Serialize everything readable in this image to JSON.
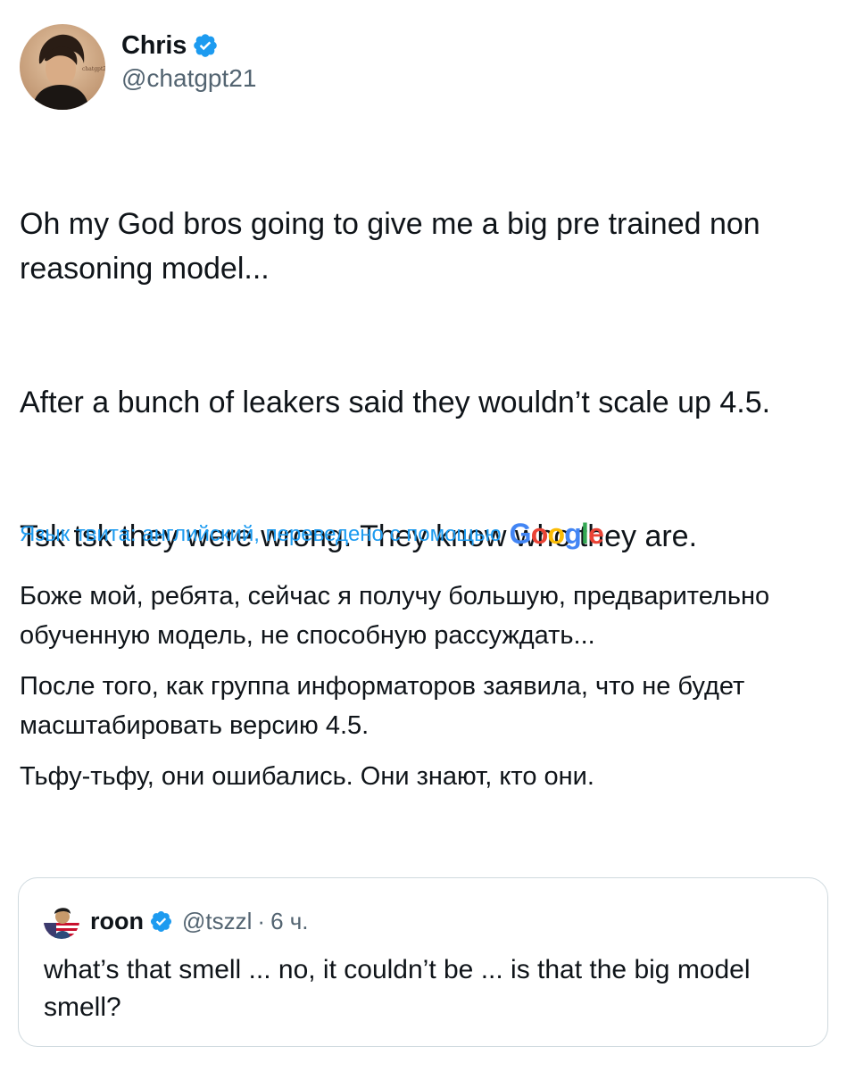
{
  "author": {
    "name": "Chris",
    "handle": "@chatgpt21",
    "avatar_label": "chatgpt21",
    "verified_icon": "verified-badge-icon"
  },
  "tweet": {
    "paragraphs": [
      "Oh my God bros going to give me a big pre trained non reasoning model...",
      "After a bunch of leakers said they wouldn’t scale up 4.5.",
      "Tsk tsk they were wrong. They know who they are."
    ]
  },
  "translation": {
    "label": "Язык твита: английский, переведено с помощью",
    "provider": "Google",
    "paragraphs": [
      "Боже мой, ребята, сейчас я получу большую, предварительно обученную модель, не способную рассуждать...",
      "После того, как группа информаторов заявила, что не будет масштабировать версию 4.5.",
      "Тьфу-тьфу, они ошибались. Они знают, кто они."
    ]
  },
  "quoted_tweet": {
    "name": "roon",
    "handle": "@tszzl",
    "separator": "·",
    "time": "6 ч.",
    "text": "what’s that smell ... no, it couldn’t be ... is that the big model smell?"
  },
  "colors": {
    "text": "#0f1419",
    "secondary": "#536471",
    "link": "#1d9bf0",
    "border": "#cfd9de",
    "verified": "#1d9bf0"
  }
}
